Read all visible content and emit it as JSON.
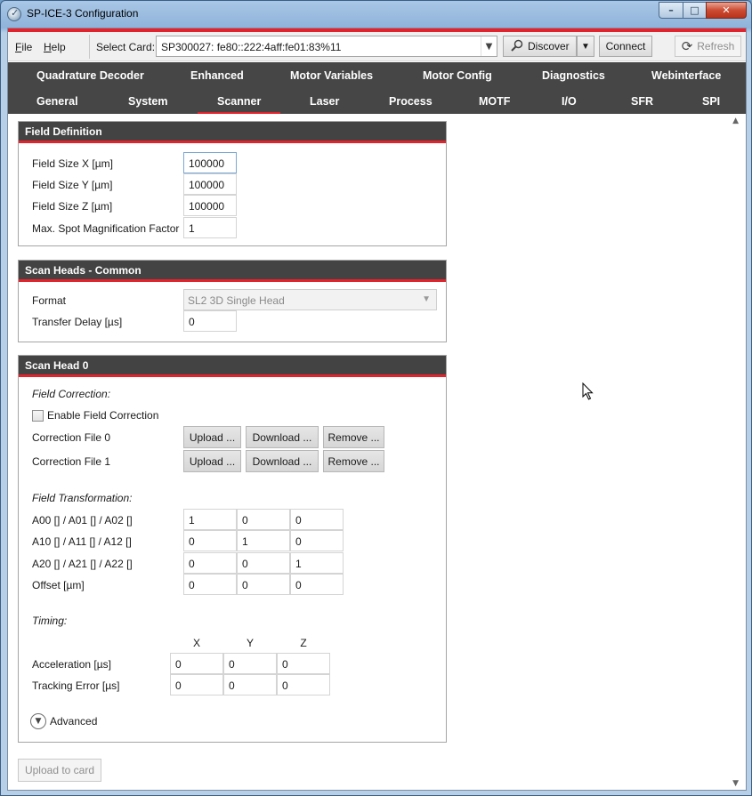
{
  "window": {
    "title": "SP-ICE-3 Configuration",
    "minimize": "–",
    "maximize": "□",
    "close": "✕"
  },
  "menu": {
    "file": "F",
    "file_rest": "ile",
    "help": "H",
    "help_rest": "elp"
  },
  "card": {
    "label": "Select Card:",
    "value": "SP300027: fe80::222:4aff:fe01:83%11"
  },
  "toolbar": {
    "discover": "Discover",
    "connect": "Connect",
    "refresh": "Refresh"
  },
  "tabs": {
    "row1": [
      "Quadrature Decoder",
      "Enhanced",
      "Motor Variables",
      "Motor Config",
      "Diagnostics",
      "Webinterface"
    ],
    "row2": [
      "General",
      "System",
      "Scanner",
      "Laser",
      "Process",
      "MOTF",
      "I/O",
      "SFR",
      "SPI"
    ],
    "active": "Scanner"
  },
  "field_definition": {
    "title": "Field Definition",
    "size_x_label": "Field Size X [µm]",
    "size_x": "100000",
    "size_y_label": "Field Size Y [µm]",
    "size_y": "100000",
    "size_z_label": "Field Size Z [µm]",
    "size_z": "100000",
    "spot_label": "Max. Spot Magnification Factor",
    "spot": "1"
  },
  "scan_heads_common": {
    "title": "Scan Heads - Common",
    "format_label": "Format",
    "format_value": "SL2 3D Single Head",
    "delay_label": "Transfer Delay [µs]",
    "delay": "0"
  },
  "scan_head_0": {
    "title": "Scan Head 0",
    "field_correction": "Field Correction:",
    "enable_label": "Enable Field Correction",
    "file0_label": "Correction File 0",
    "file1_label": "Correction File 1",
    "upload": "Upload ...",
    "download": "Download ...",
    "remove": "Remove ...",
    "field_transformation": "Field Transformation:",
    "matrix_rows": [
      {
        "label": "A00 [] / A01 [] / A02 []",
        "values": [
          "1",
          "0",
          "0"
        ]
      },
      {
        "label": "A10 [] / A11 [] / A12 []",
        "values": [
          "0",
          "1",
          "0"
        ]
      },
      {
        "label": "A20 [] / A21 [] / A22 []",
        "values": [
          "0",
          "0",
          "1"
        ]
      },
      {
        "label": "Offset [µm]",
        "values": [
          "0",
          "0",
          "0"
        ]
      }
    ],
    "timing": "Timing:",
    "columns": [
      "X",
      "Y",
      "Z"
    ],
    "timing_rows": [
      {
        "label": "Acceleration [µs]",
        "values": [
          "0",
          "0",
          "0"
        ]
      },
      {
        "label": "Tracking Error [µs]",
        "values": [
          "0",
          "0",
          "0"
        ]
      }
    ],
    "advanced": "Advanced"
  },
  "footer": {
    "upload_to_card": "Upload to card"
  },
  "icons": {
    "discover": "magnifier-icon",
    "refresh": "refresh-icon",
    "advanced": "chevron-down-icon"
  },
  "colors": {
    "accent_red": "#e3222b",
    "tab_bar": "#464646",
    "group_header": "#434343"
  }
}
